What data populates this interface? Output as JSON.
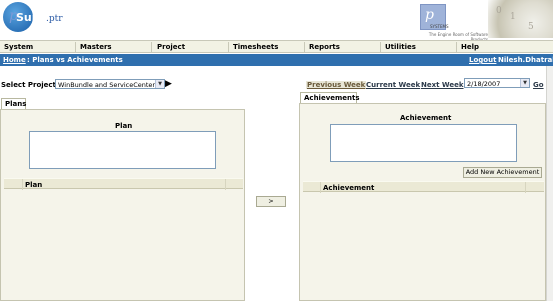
{
  "header": {
    "logo_text": "Suite",
    "logo_suffix": ".ptr",
    "logo_mark": "p",
    "partner_mark": "p",
    "partner_name": "SYSTEMS",
    "partner_tagline": "The Engine Room of Software Products"
  },
  "menu": {
    "items": [
      "System",
      "Masters",
      "Project",
      "Timesheets",
      "Reports",
      "Utilities",
      "Help"
    ]
  },
  "breadcrumb": {
    "home": "Home",
    "separator_title": " : Plans vs Achievements",
    "logout": "Logout",
    "user": "Nilesh.Dhatrak"
  },
  "filters": {
    "project_label": "Select Project:",
    "project_value": "WinBundle and ServiceCenter",
    "previous_week": "Previous Week",
    "current_week": "Current Week",
    "next_week": "Next Week",
    "date_value": "2/18/2007",
    "go": "Go"
  },
  "plans": {
    "tab": "Plans",
    "title": "Plan",
    "column": "Plan"
  },
  "achievements": {
    "tab": "Achievements",
    "title": "Achievement",
    "add_button": "Add New Achievement",
    "column": "Achievement"
  },
  "transfer_button": ">",
  "icons": {
    "dropdown": "chevron-down-icon",
    "go_arrow": "play-arrow-icon"
  },
  "colors": {
    "nav_blue": "#2f6fae",
    "menu_bg": "#f2f2e4",
    "panel_bg": "#f5f4ea"
  }
}
